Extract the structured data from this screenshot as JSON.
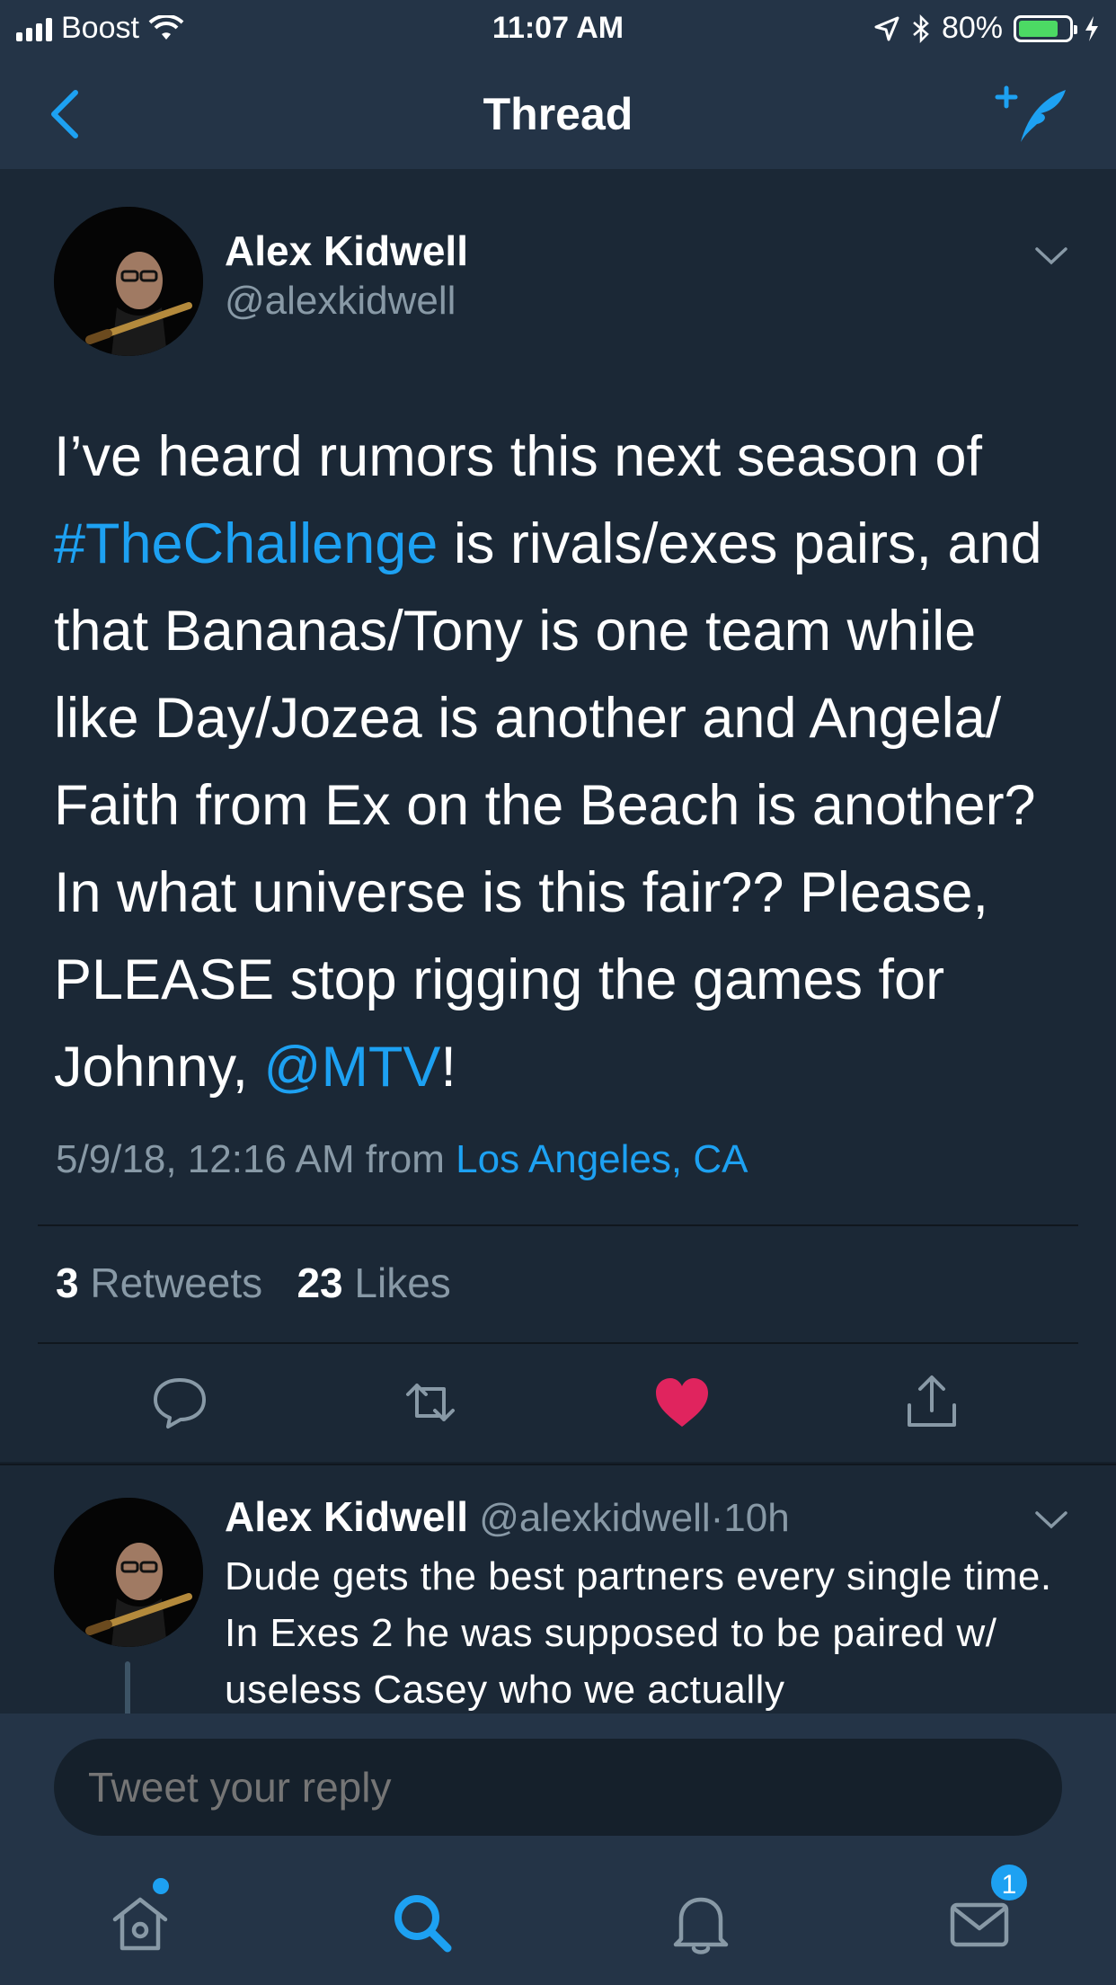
{
  "status_bar": {
    "carrier": "Boost",
    "time": "11:07 AM",
    "battery": "80%",
    "battery_level": 0.8,
    "icons": [
      "signal-icon",
      "wifi-icon",
      "location-icon",
      "bluetooth-icon",
      "battery-icon",
      "charging-icon"
    ]
  },
  "nav": {
    "title": "Thread",
    "back_icon": "chevron-left-icon",
    "compose_icon": "compose-tweet-icon"
  },
  "main_tweet": {
    "name": "Alex Kidwell",
    "handle": "@alexkidwell",
    "text_part1": "I’ve heard rumors this next season of ",
    "hashtag": "#TheChallenge",
    "text_part2": " is rivals/exes pairs, and that Bananas/Tony is one team while like Day/Jozea is another and Angela/ Faith from Ex on the Beach is another? In what universe is this fair?? Please, PLEASE stop rigging the games for Johnny, ",
    "mention": "@MTV",
    "text_part3": "!",
    "timestamp": "5/9/18, 12:16 AM",
    "from_label": "from",
    "location": "Los Angeles, CA",
    "retweets_count": "3",
    "retweets_label": "Retweets",
    "likes_count": "23",
    "likes_label": "Likes",
    "liked": true,
    "actions": [
      "reply-icon",
      "retweet-icon",
      "like-icon",
      "share-icon"
    ]
  },
  "reply_tweet": {
    "name": "Alex Kidwell",
    "handle": "@alexkidwell",
    "separator": "·",
    "time_ago": "10h",
    "text": "Dude gets the best partners every single time. In Exes 2 he was supposed to be paired w/ useless Casey who we actually"
  },
  "reply_box": {
    "placeholder": "Tweet your reply"
  },
  "tab_bar": {
    "tabs": [
      "home-icon",
      "search-icon",
      "notifications-icon",
      "messages-icon"
    ],
    "active": "search-icon",
    "messages_badge": "1"
  },
  "colors": {
    "background": "#15202b",
    "surface": "#1b2836",
    "bars": "#243447",
    "accent": "#1da1f2",
    "secondary_text": "#8899a6",
    "like": "#e0245e"
  }
}
